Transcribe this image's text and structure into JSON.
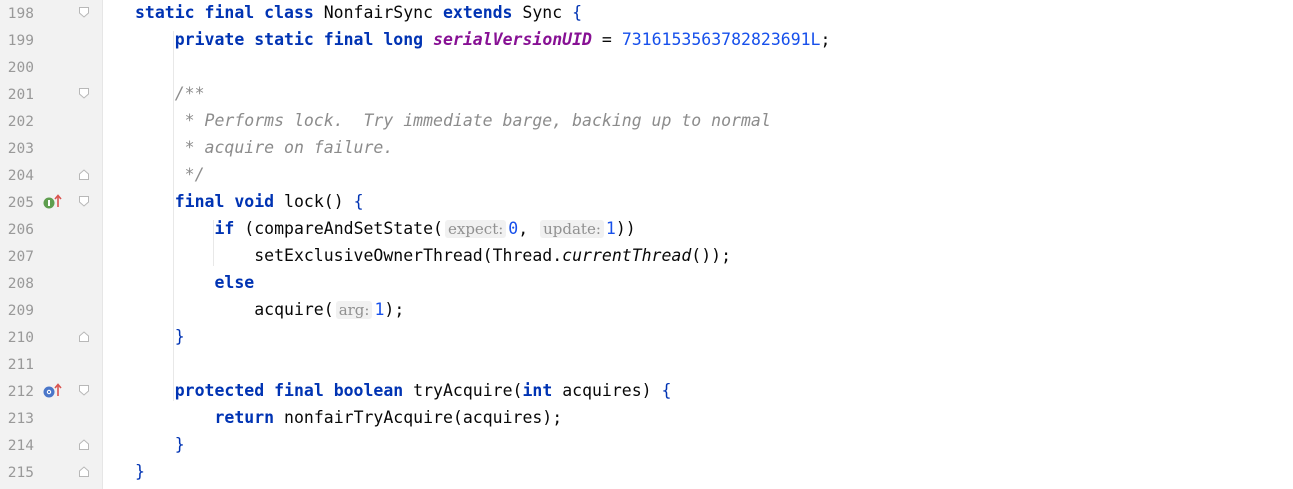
{
  "editor": {
    "lines": [
      {
        "num": "198",
        "fold": "open",
        "parts": [
          {
            "t": "static final class",
            "c": "kw"
          },
          {
            "t": " NonfairSync "
          },
          {
            "t": "extends",
            "c": "kw"
          },
          {
            "t": " Sync "
          },
          {
            "t": "{",
            "c": "brc"
          }
        ]
      },
      {
        "num": "199",
        "parts": [
          {
            "t": "    "
          },
          {
            "t": "private static final long",
            "c": "kw"
          },
          {
            "t": " "
          },
          {
            "t": "serialVersionUID",
            "c": "fld"
          },
          {
            "t": " = "
          },
          {
            "t": "7316153563782823691L",
            "c": "num"
          },
          {
            "t": ";"
          }
        ]
      },
      {
        "num": "200",
        "parts": []
      },
      {
        "num": "201",
        "fold": "open",
        "parts": [
          {
            "t": "    /**",
            "c": "cm"
          }
        ]
      },
      {
        "num": "202",
        "parts": [
          {
            "t": "     * Performs lock.  Try immediate barge, backing up to normal",
            "c": "cm"
          }
        ]
      },
      {
        "num": "203",
        "parts": [
          {
            "t": "     * acquire on failure.",
            "c": "cm"
          }
        ]
      },
      {
        "num": "204",
        "fold": "close",
        "parts": [
          {
            "t": "     */",
            "c": "cm"
          }
        ]
      },
      {
        "num": "205",
        "fold": "open",
        "marker": "implements-up",
        "parts": [
          {
            "t": "    "
          },
          {
            "t": "final void",
            "c": "kw"
          },
          {
            "t": " lock() "
          },
          {
            "t": "{",
            "c": "brc"
          }
        ]
      },
      {
        "num": "206",
        "parts": [
          {
            "t": "        "
          },
          {
            "t": "if",
            "c": "kw"
          },
          {
            "t": " (compareAndSetState("
          },
          {
            "t": "expect:",
            "c": "hint"
          },
          {
            "t": "0",
            "c": "num"
          },
          {
            "t": ", "
          },
          {
            "t": "update:",
            "c": "hint"
          },
          {
            "t": "1",
            "c": "num"
          },
          {
            "t": "))"
          }
        ]
      },
      {
        "num": "207",
        "parts": [
          {
            "t": "            setExclusiveOwnerThread(Thread."
          },
          {
            "t": "currentThread",
            "c": "it"
          },
          {
            "t": "());"
          }
        ]
      },
      {
        "num": "208",
        "parts": [
          {
            "t": "        "
          },
          {
            "t": "else",
            "c": "kw"
          }
        ]
      },
      {
        "num": "209",
        "parts": [
          {
            "t": "            acquire("
          },
          {
            "t": "arg:",
            "c": "hint"
          },
          {
            "t": "1",
            "c": "num"
          },
          {
            "t": ");"
          }
        ]
      },
      {
        "num": "210",
        "fold": "close",
        "parts": [
          {
            "t": "    "
          },
          {
            "t": "}",
            "c": "brc"
          }
        ]
      },
      {
        "num": "211",
        "parts": []
      },
      {
        "num": "212",
        "fold": "open",
        "marker": "overrides-up",
        "parts": [
          {
            "t": "    "
          },
          {
            "t": "protected final boolean",
            "c": "kw"
          },
          {
            "t": " tryAcquire("
          },
          {
            "t": "int",
            "c": "kw"
          },
          {
            "t": " acquires) "
          },
          {
            "t": "{",
            "c": "brc"
          }
        ]
      },
      {
        "num": "213",
        "parts": [
          {
            "t": "        "
          },
          {
            "t": "return",
            "c": "kw"
          },
          {
            "t": " nonfairTryAcquire(acquires);"
          }
        ]
      },
      {
        "num": "214",
        "fold": "close",
        "parts": [
          {
            "t": "    "
          },
          {
            "t": "}",
            "c": "brc"
          }
        ]
      },
      {
        "num": "215",
        "fold": "close",
        "parts": [
          {
            "t": "}",
            "c": "brc"
          }
        ]
      }
    ]
  },
  "markers": {
    "implements-up": {
      "icon": "implements-method-icon",
      "color": "#5f9e4f",
      "arrow": "#d9534f"
    },
    "overrides-up": {
      "icon": "overrides-method-icon",
      "color": "#4a76c9",
      "arrow": "#d9534f"
    }
  }
}
